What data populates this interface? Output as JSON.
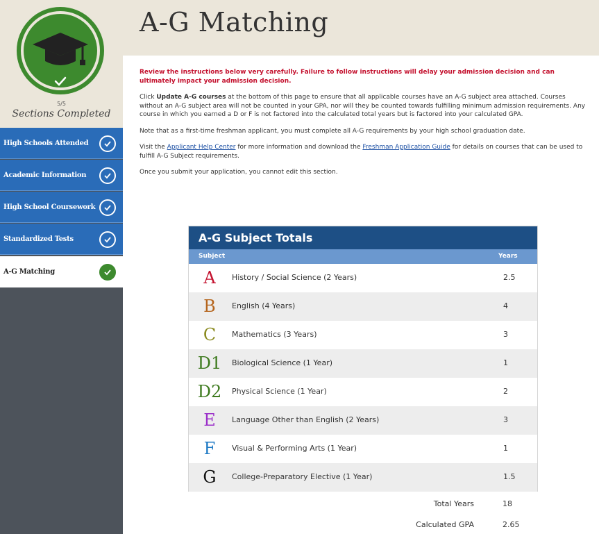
{
  "sidebar": {
    "progress_count": "5/5",
    "progress_label": "Sections Completed",
    "items": [
      {
        "label": "High Schools Attended",
        "state": "completed"
      },
      {
        "label": "Academic Information",
        "state": "completed"
      },
      {
        "label": "High School Coursework",
        "state": "completed"
      },
      {
        "label": "Standardized Tests",
        "state": "completed"
      },
      {
        "label": "A-G Matching",
        "state": "active"
      }
    ]
  },
  "header": {
    "title": "A-G Matching"
  },
  "instructions": {
    "warning": "Review the instructions below very carefully. Failure to follow instructions will delay your admission decision and can ultimately impact your admission decision.",
    "p1_before": "Click ",
    "p1_bold": "Update A-G courses",
    "p1_after": " at the bottom of this page to ensure that all applicable courses have an A-G subject area attached. Courses without an A-G subject area will not be counted in your GPA, nor will they be counted towards fulfilling minimum admission requirements. Any course in which you earned a D or F is not factored into the calculated total years but is factored into your calculated GPA.",
    "p2": "Note that as a first-time freshman applicant, you must complete all A-G requirements by your high school graduation date.",
    "p3_before": "Visit the ",
    "p3_link1": "Applicant Help Center",
    "p3_middle": " for more information and download the ",
    "p3_link2": "Freshman Application Guide",
    "p3_after": " for details on courses that can be used to fulfill A-G Subject requirements.",
    "p4": "Once you submit your application, you cannot edit this section."
  },
  "table": {
    "title": "A-G Subject Totals",
    "col_subject": "Subject",
    "col_years": "Years",
    "rows": [
      {
        "letter": "A",
        "color": "#c4122f",
        "subject": "History / Social Science (2 Years)",
        "years": "2.5"
      },
      {
        "letter": "B",
        "color": "#b5651d",
        "subject": "English (4 Years)",
        "years": "4"
      },
      {
        "letter": "C",
        "color": "#8a8a1e",
        "subject": "Mathematics (3 Years)",
        "years": "3"
      },
      {
        "letter": "D1",
        "color": "#3d7a1e",
        "subject": "Biological Science (1 Year)",
        "years": "1"
      },
      {
        "letter": "D2",
        "color": "#3d7a1e",
        "subject": "Physical Science (1 Year)",
        "years": "2"
      },
      {
        "letter": "E",
        "color": "#9b2fc9",
        "subject": "Language Other than English (2 Years)",
        "years": "3"
      },
      {
        "letter": "F",
        "color": "#1f7ac4",
        "subject": "Visual & Performing Arts (1 Year)",
        "years": "1"
      },
      {
        "letter": "G",
        "color": "#111111",
        "subject": "College-Preparatory Elective (1 Year)",
        "years": "1.5"
      }
    ]
  },
  "totals": {
    "total_years_label": "Total Years",
    "total_years_value": "18",
    "gpa_label": "Calculated GPA",
    "gpa_value": "2.65"
  },
  "colors": {
    "ring_green": "#3d8a2e",
    "nav_blue": "#2a6cb8",
    "table_header": "#1d4f85",
    "column_header": "#6b98cf",
    "warning_red": "#c4122f"
  }
}
